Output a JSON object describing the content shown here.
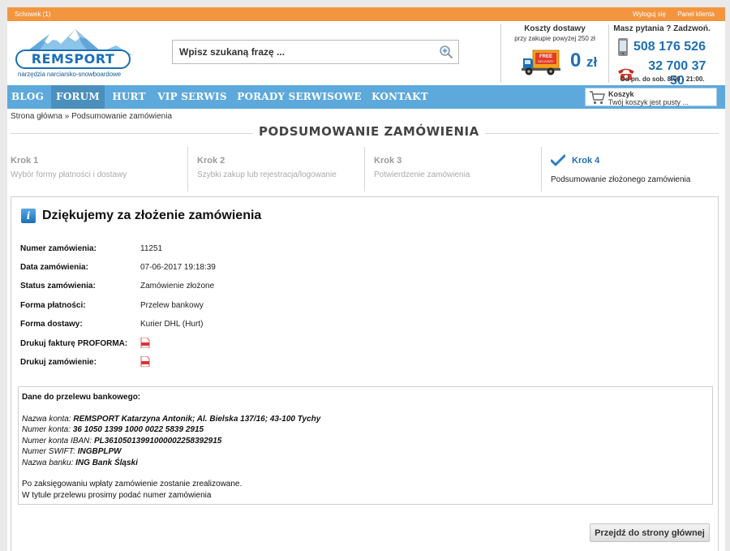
{
  "topbar": {
    "clipboard": "Schowek (1)",
    "logout": "Wyloguj się",
    "client_panel": "Panel klienta"
  },
  "logo": {
    "name": "REMSPORT",
    "tagline": "narzędzia narciarsko-snowboardowe"
  },
  "search": {
    "placeholder": "Wpisz szukaną frazę ..."
  },
  "delivery": {
    "title": "Koszty dostawy",
    "subtitle": "przy zakupie powyżej 250 zł",
    "badge": "FREE DELIVERY",
    "price": "0",
    "currency": "zł"
  },
  "contact": {
    "title": "Masz pytania ? Zadzwoń.",
    "mobile": "508 176 526",
    "phone": "32 700 37 50",
    "hours": "Od pn. do sob. 8:00 - 21:00."
  },
  "nav": {
    "items": [
      "Blog",
      "Forum",
      "Hurt",
      "VIP Serwis",
      "Porady serwisowe",
      "Kontakt"
    ],
    "active": "Forum"
  },
  "cart": {
    "title": "Koszyk",
    "status": "Twój koszyk jest pusty ..."
  },
  "breadcrumb": {
    "home": "Strona główna",
    "sep": " » ",
    "current": "Podsumowanie zamówienia"
  },
  "page_title": "PODSUMOWANIE ZAMÓWIENIA",
  "steps": [
    {
      "number": "Krok 1",
      "desc": "Wybór formy płatności i dostawy"
    },
    {
      "number": "Krok 2",
      "desc": "Szybki zakup lub rejestracja/logowanie"
    },
    {
      "number": "Krok 3",
      "desc": "Potwierdzenie zamówienia"
    },
    {
      "number": "Krok 4",
      "desc": "Podsumowanie złożonego zamówienia"
    }
  ],
  "order": {
    "heading": "Dziękujemy za złożenie zamówienia",
    "fields": [
      {
        "label": "Numer zamówienia:",
        "value": "11251"
      },
      {
        "label": "Data zamówienia:",
        "value": "07-06-2017 19:18:39"
      },
      {
        "label": "Status zamówienia:",
        "value": "Zamówienie złożone"
      },
      {
        "label": "Forma płatności:",
        "value": "Przelew bankowy"
      },
      {
        "label": "Forma dostawy:",
        "value": "Kurier DHL (Hurt)"
      }
    ],
    "print_invoice": "Drukuj fakturę PROFORMA:",
    "print_order": "Drukuj zamówienie:"
  },
  "bank": {
    "title": "Dane do przelewu bankowego:",
    "owner_label": "Nazwa konta:",
    "owner": "REMSPORT Katarzyna Antonik; Al. Bielska 137/16; 43-100 Tychy",
    "account_label": "Numer konta:",
    "account": "36 1050 1399 1000 0022 5839 2915",
    "iban_label": "Numer konta IBAN:",
    "iban": "PL36105013991000002258392915",
    "swift_label": "Numer SWIFT:",
    "swift": "INGBPLPW",
    "bank_label": "Nazwa banku:",
    "bank": "ING Bank Śląski",
    "note1": "Po zaksięgowaniu wpłaty zamówienie zostanie zrealizowane.",
    "note2": "W tytule przelewu prosimy podać numer zamówienia"
  },
  "home_button": "Przejdź do strony głównej",
  "colors": {
    "orange": "#f3953f",
    "nav_blue": "#5da9dc",
    "brand_blue": "#1f6fb3"
  }
}
